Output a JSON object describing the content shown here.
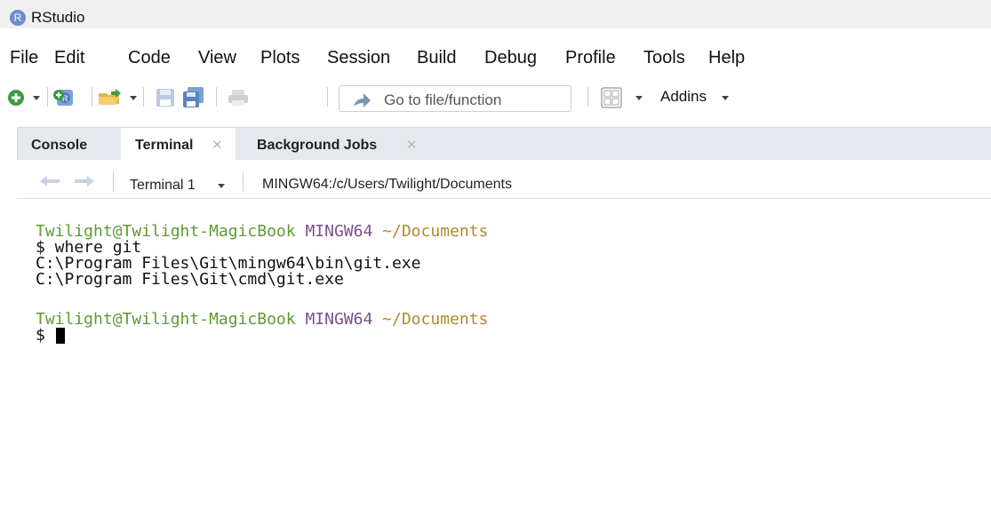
{
  "app": {
    "title": "RStudio",
    "logo_letter": "R"
  },
  "menu": [
    "File",
    "Edit",
    "Code",
    "View",
    "Plots",
    "Session",
    "Build",
    "Debug",
    "Profile",
    "Tools",
    "Help"
  ],
  "toolbar": {
    "goto_placeholder": "Go to file/function",
    "addins_label": "Addins"
  },
  "tabs": [
    {
      "label": "Console",
      "active": false,
      "closable": false
    },
    {
      "label": "Terminal",
      "active": true,
      "closable": true
    },
    {
      "label": "Background Jobs",
      "active": false,
      "closable": true
    }
  ],
  "terminal_toolbar": {
    "selected": "Terminal 1",
    "title": "MINGW64:/c/Users/Twilight/Documents"
  },
  "terminal": {
    "prompt_user": "Twilight@Twilight-MagicBook",
    "prompt_shell": "MINGW64",
    "prompt_path": "~/Documents",
    "command_line": "$ where git",
    "output": [
      "C:\\Program Files\\Git\\mingw64\\bin\\git.exe",
      "C:\\Program Files\\Git\\cmd\\git.exe"
    ],
    "current_prompt": "$ "
  },
  "colors": {
    "prompt_user": "#5e9a2f",
    "prompt_shell": "#7a4f8f",
    "prompt_path": "#b5892a"
  }
}
